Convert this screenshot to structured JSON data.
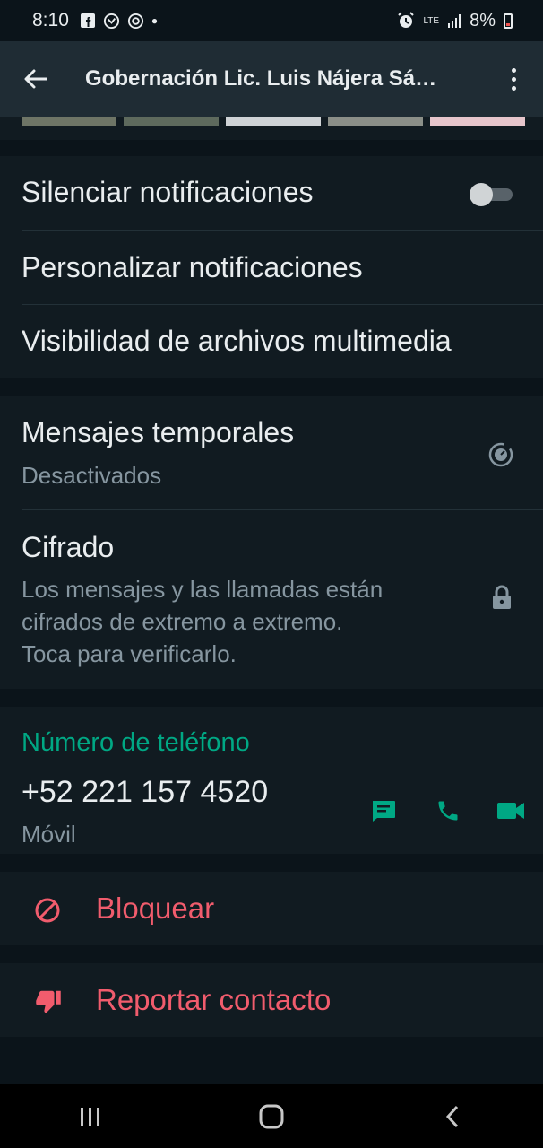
{
  "status_bar": {
    "time": "8:10",
    "left_icons": [
      "facebook-icon",
      "sync-icon",
      "app-icon",
      "dot-icon"
    ],
    "network": "LTE",
    "battery_percent": "8%"
  },
  "app_bar": {
    "title": "Gobernación Lic. Luis Nájera Sá…"
  },
  "notifications_section": {
    "mute": {
      "label": "Silenciar notificaciones",
      "enabled": false
    },
    "custom": {
      "label": "Personalizar notificaciones"
    },
    "media_visibility": {
      "label": "Visibilidad de archivos multimedia"
    }
  },
  "privacy_section": {
    "disappearing": {
      "label": "Mensajes temporales",
      "status": "Desactivados"
    },
    "encryption": {
      "label": "Cifrado",
      "description_lines": [
        "Los mensajes y las llamadas están",
        "cifrados de extremo a extremo.",
        "Toca para verificarlo."
      ]
    }
  },
  "phone_section": {
    "heading": "Número de teléfono",
    "number": "+52 221 157 4520",
    "type": "Móvil"
  },
  "actions": {
    "block": "Bloquear",
    "report": "Reportar contacto"
  },
  "colors": {
    "accent": "#00a884",
    "danger": "#f15c6d",
    "background": "#0b141a",
    "surface": "#111b21"
  }
}
